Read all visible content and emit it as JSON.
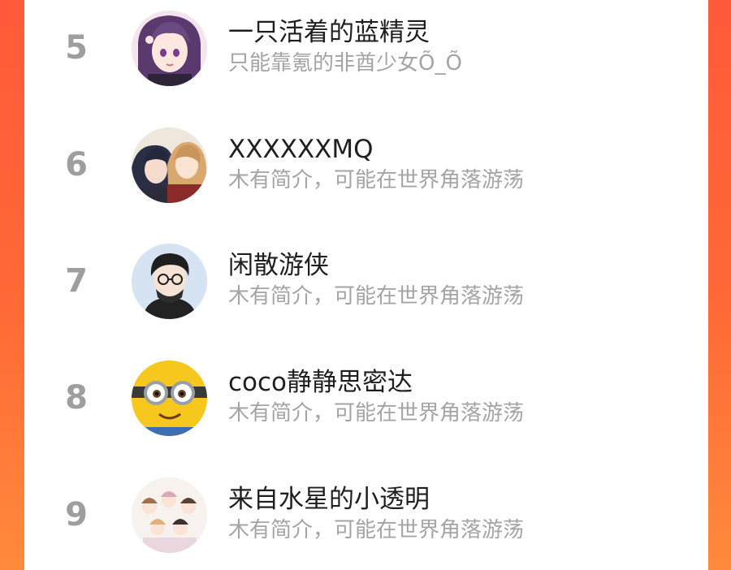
{
  "ranking": {
    "items": [
      {
        "rank": "5",
        "name": "一只活着的蓝精灵",
        "bio": "只能靠氪的非酋少女Õ_Õ",
        "avatar": "anime-girl-purple-hair-avatar"
      },
      {
        "rank": "6",
        "name": "XXXXXXMQ",
        "bio": "木有简介，可能在世界角落游荡",
        "avatar": "anime-couple-avatar"
      },
      {
        "rank": "7",
        "name": "闲散游侠",
        "bio": "木有简介，可能在世界角落游荡",
        "avatar": "cartoon-boy-glasses-avatar"
      },
      {
        "rank": "8",
        "name": "coco静静思密达",
        "bio": "木有简介，可能在世界角落游荡",
        "avatar": "minion-avatar"
      },
      {
        "rank": "9",
        "name": "来自水星的小透明",
        "bio": "木有简介，可能在世界角落游荡",
        "avatar": "anime-group-avatar"
      }
    ]
  },
  "colors": {
    "background_gradient_start": "#ff5a3a",
    "background_gradient_end": "#ff8a3c",
    "rank_number": "#9e9e9e",
    "name_text": "#1f1f1f",
    "bio_text": "#a4a4a4"
  }
}
